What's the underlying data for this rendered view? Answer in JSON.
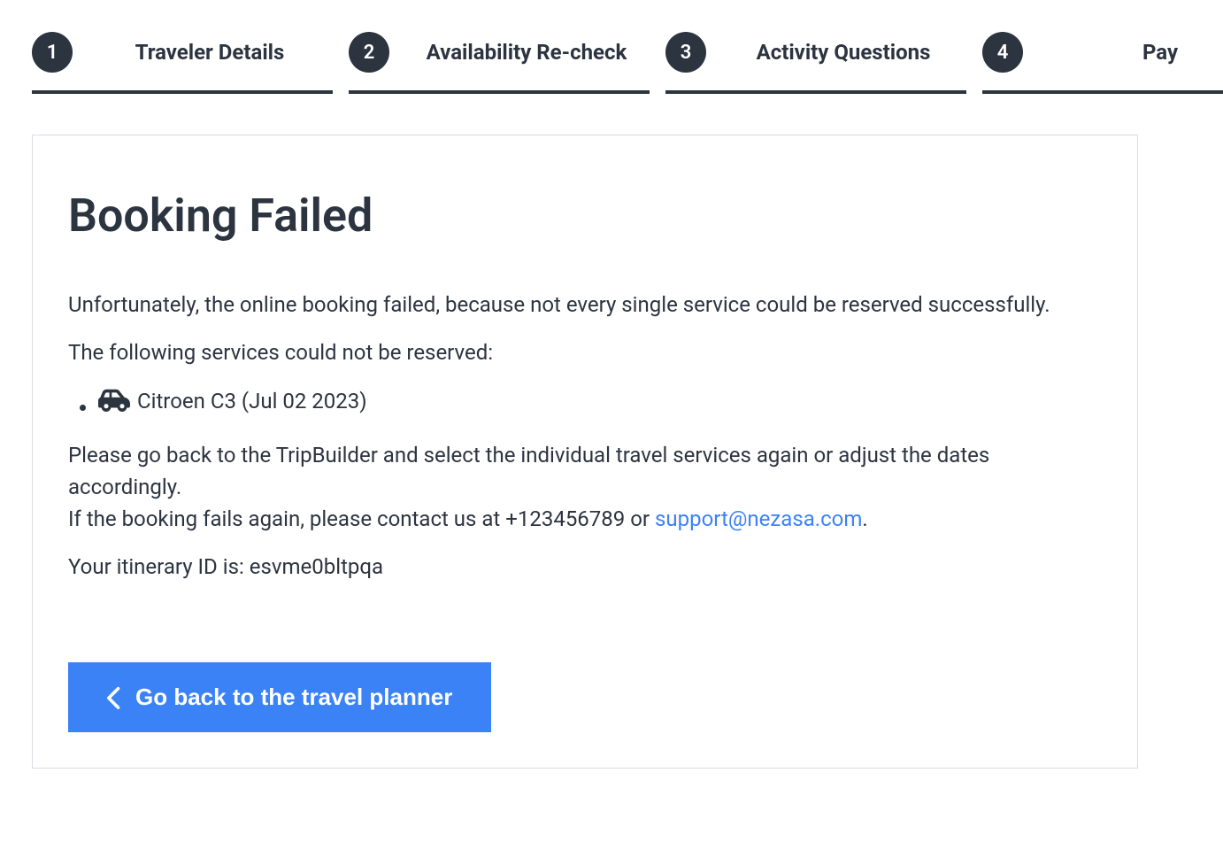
{
  "stepper": {
    "steps": [
      {
        "number": "1",
        "label": "Traveler Details"
      },
      {
        "number": "2",
        "label": "Availability Re-check"
      },
      {
        "number": "3",
        "label": "Activity Questions"
      },
      {
        "number": "4",
        "label": "Pay"
      }
    ]
  },
  "content": {
    "heading": "Booking Failed",
    "intro": "Unfortunately, the online booking failed, because not every single service could be reserved successfully.",
    "services_intro": "The following services could not be reserved:",
    "failed_services": [
      {
        "icon": "car-icon",
        "text": "Citroen C3 (Jul 02 2023)"
      }
    ],
    "instructions_line1": "Please go back to the TripBuilder and select the individual travel services again or adjust the dates accordingly.",
    "instructions_line2_prefix": "If the booking fails again, please contact us at ",
    "contact_phone": "+123456789",
    "instructions_line2_sep": " or ",
    "contact_email": "support@nezasa.com",
    "instructions_line2_suffix": ".",
    "itinerary_prefix": "Your itinerary ID is: ",
    "itinerary_id": "esvme0bltpqa",
    "back_button": "Go back to the travel planner"
  }
}
